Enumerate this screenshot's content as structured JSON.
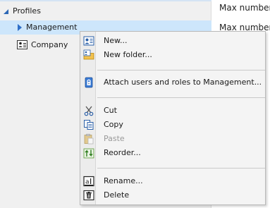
{
  "tree": {
    "items": [
      {
        "label": "Profiles",
        "expanded": true
      },
      {
        "label": "Management",
        "selected": true
      },
      {
        "label": "Company"
      }
    ]
  },
  "detail": {
    "lines": [
      "Max number of",
      "Max number of"
    ]
  },
  "context_menu": {
    "items": [
      {
        "label": "New...",
        "icon": "new-user-icon",
        "enabled": true
      },
      {
        "label": "New folder...",
        "icon": "new-folder-icon",
        "enabled": true
      },
      {
        "label": "Attach users and roles to Management...",
        "icon": "lock-icon",
        "enabled": true
      },
      {
        "label": "Cut",
        "icon": "scissors-icon",
        "enabled": true
      },
      {
        "label": "Copy",
        "icon": "copy-icon",
        "enabled": true
      },
      {
        "label": "Paste",
        "icon": "paste-icon",
        "enabled": false
      },
      {
        "label": "Reorder...",
        "icon": "reorder-icon",
        "enabled": true
      },
      {
        "label": "Rename...",
        "icon": "rename-icon",
        "enabled": true
      },
      {
        "label": "Delete",
        "icon": "trash-icon",
        "enabled": true
      }
    ]
  },
  "colors": {
    "selection": "#cde6fb",
    "tree_arrow": "#2c67b5"
  }
}
